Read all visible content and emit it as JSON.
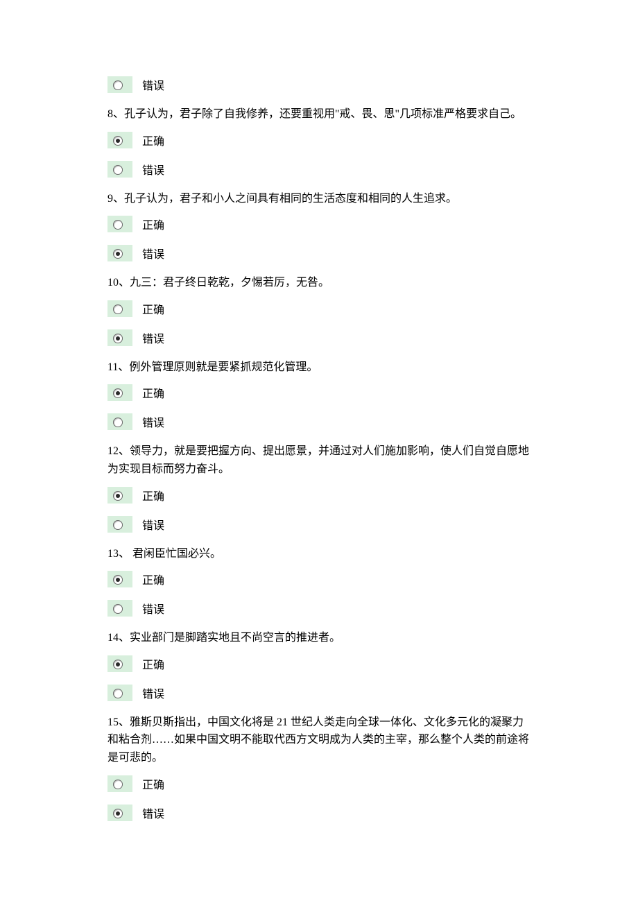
{
  "labels": {
    "correct": "正确",
    "wrong": "错误"
  },
  "questions": [
    {
      "id": "q7",
      "text": "",
      "options": [
        {
          "key": "wrong",
          "selected": false
        }
      ]
    },
    {
      "id": "q8",
      "text": "8、孔子认为，君子除了自我修养，还要重视用\"戒、畏、思\"几项标准严格要求自己。",
      "options": [
        {
          "key": "correct",
          "selected": true
        },
        {
          "key": "wrong",
          "selected": false
        }
      ]
    },
    {
      "id": "q9",
      "text": "9、孔子认为，君子和小人之间具有相同的生活态度和相同的人生追求。",
      "options": [
        {
          "key": "correct",
          "selected": false
        },
        {
          "key": "wrong",
          "selected": true
        }
      ]
    },
    {
      "id": "q10",
      "text": "10、九三：君子终日乾乾，夕惕若厉，无咎。",
      "options": [
        {
          "key": "correct",
          "selected": false
        },
        {
          "key": "wrong",
          "selected": true
        }
      ]
    },
    {
      "id": "q11",
      "text": "11、例外管理原则就是要紧抓规范化管理。",
      "options": [
        {
          "key": "correct",
          "selected": true
        },
        {
          "key": "wrong",
          "selected": false
        }
      ]
    },
    {
      "id": "q12",
      "text": "12、领导力，就是要把握方向、提出愿景，并通过对人们施加影响，使人们自觉自愿地为实现目标而努力奋斗。",
      "options": [
        {
          "key": "correct",
          "selected": true
        },
        {
          "key": "wrong",
          "selected": false
        }
      ]
    },
    {
      "id": "q13",
      "text": "13、 君闲臣忙国必兴。",
      "options": [
        {
          "key": "correct",
          "selected": true
        },
        {
          "key": "wrong",
          "selected": false
        }
      ]
    },
    {
      "id": "q14",
      "text": "14、实业部门是脚踏实地且不尚空言的推进者。",
      "options": [
        {
          "key": "correct",
          "selected": true
        },
        {
          "key": "wrong",
          "selected": false
        }
      ]
    },
    {
      "id": "q15",
      "text": "15、雅斯贝斯指出，中国文化将是 21 世纪人类走向全球一体化、文化多元化的凝聚力和粘合剂……如果中国文明不能取代西方文明成为人类的主宰，那么整个人类的前途将是可悲的。",
      "options": [
        {
          "key": "correct",
          "selected": false
        },
        {
          "key": "wrong",
          "selected": true
        }
      ]
    }
  ]
}
